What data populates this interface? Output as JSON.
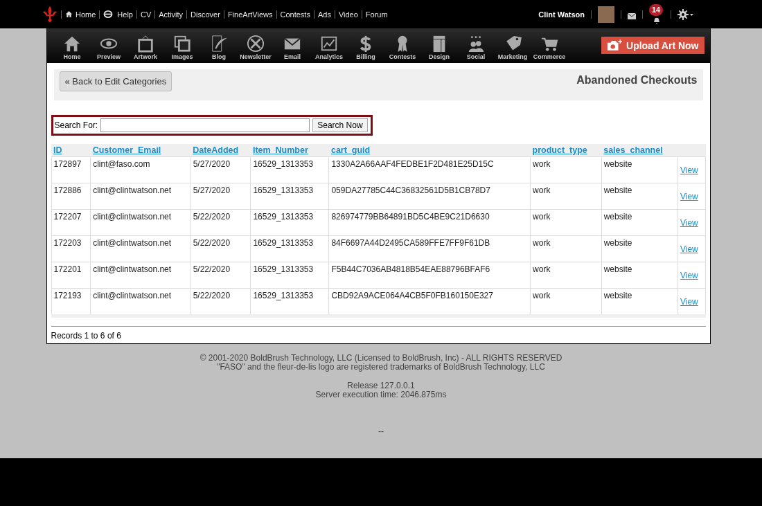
{
  "top_nav": {
    "links": [
      {
        "label": "Home",
        "kind": "home"
      },
      {
        "label": "Help",
        "kind": "help"
      },
      {
        "label": "CV",
        "kind": "plain"
      },
      {
        "label": "Activity",
        "kind": "plain"
      },
      {
        "label": "Discover",
        "kind": "plain"
      },
      {
        "label": "FineArtViews",
        "kind": "plain"
      },
      {
        "label": "Contests",
        "kind": "plain"
      },
      {
        "label": "Ads",
        "kind": "plain"
      },
      {
        "label": "Video",
        "kind": "plain"
      },
      {
        "label": "Forum",
        "kind": "plain"
      }
    ],
    "user_name": "Clint Watson",
    "notification_count": "14"
  },
  "toolbar": {
    "items": [
      {
        "label": "Home"
      },
      {
        "label": "Preview"
      },
      {
        "label": "Artwork"
      },
      {
        "label": "Images"
      },
      {
        "label": "Blog"
      },
      {
        "label": "Newsletter"
      },
      {
        "label": "Email"
      },
      {
        "label": "Analytics"
      },
      {
        "label": "Billing"
      },
      {
        "label": "Contests"
      },
      {
        "label": "Design"
      },
      {
        "label": "Social"
      },
      {
        "label": "Marketing"
      },
      {
        "label": "Commerce"
      }
    ],
    "upload_button": "Upload Art Now"
  },
  "back_button": "« Back to Edit Categories",
  "page_title": "Abandoned Checkouts",
  "search": {
    "label": "Search For:",
    "button": "Search Now"
  },
  "table": {
    "columns": [
      "ID",
      "Customer_Email",
      "DateAdded",
      "Item_Number",
      "cart_guid",
      "product_type",
      "sales_channel"
    ],
    "rows": [
      {
        "cells": [
          "172897",
          "clint@faso.com",
          "5/27/2020",
          "16529_1313353",
          "1330A2A66AAF4FEDBE1F2D481E25D15C",
          "work",
          "website"
        ],
        "link": "View"
      },
      {
        "cells": [
          "172886",
          "clint@clintwatson.net",
          "5/27/2020",
          "16529_1313353",
          "059DA27785C44C36832561D5B1CB78D7",
          "work",
          "website"
        ],
        "link": "View"
      },
      {
        "cells": [
          "172207",
          "clint@clintwatson.net",
          "5/22/2020",
          "16529_1313353",
          "826974779BB64891BD5C4BE9C21D6630",
          "work",
          "website"
        ],
        "link": "View"
      },
      {
        "cells": [
          "172203",
          "clint@clintwatson.net",
          "5/22/2020",
          "16529_1313353",
          "84F6697A44D2495CA589FFE7FF9F61DB",
          "work",
          "website"
        ],
        "link": "View"
      },
      {
        "cells": [
          "172201",
          "clint@clintwatson.net",
          "5/22/2020",
          "16529_1313353",
          "F5B44C7036AB4818B54EAE88796BFAF6",
          "work",
          "website"
        ],
        "link": "View"
      },
      {
        "cells": [
          "172193",
          "clint@clintwatson.net",
          "5/22/2020",
          "16529_1313353",
          "CBD92A9ACE064A4CB5F0FB160150E327",
          "work",
          "website"
        ],
        "link": "View"
      }
    ]
  },
  "records": "Records 1 to 6 of 6",
  "footer": {
    "lines": [
      "© 2001-2020 BoldBrush Technology, LLC (Licensed to BoldBrush, Inc) - ALL RIGHTS RESERVED",
      "\"FASO\" and the fleur-de-lis logo are registered trademarks of BoldBrush Technology, LLC"
    ],
    "release_lines": [
      "Release 127.0.0.1",
      "Server execution time: 2046.875ms"
    ],
    "mark": "--"
  }
}
